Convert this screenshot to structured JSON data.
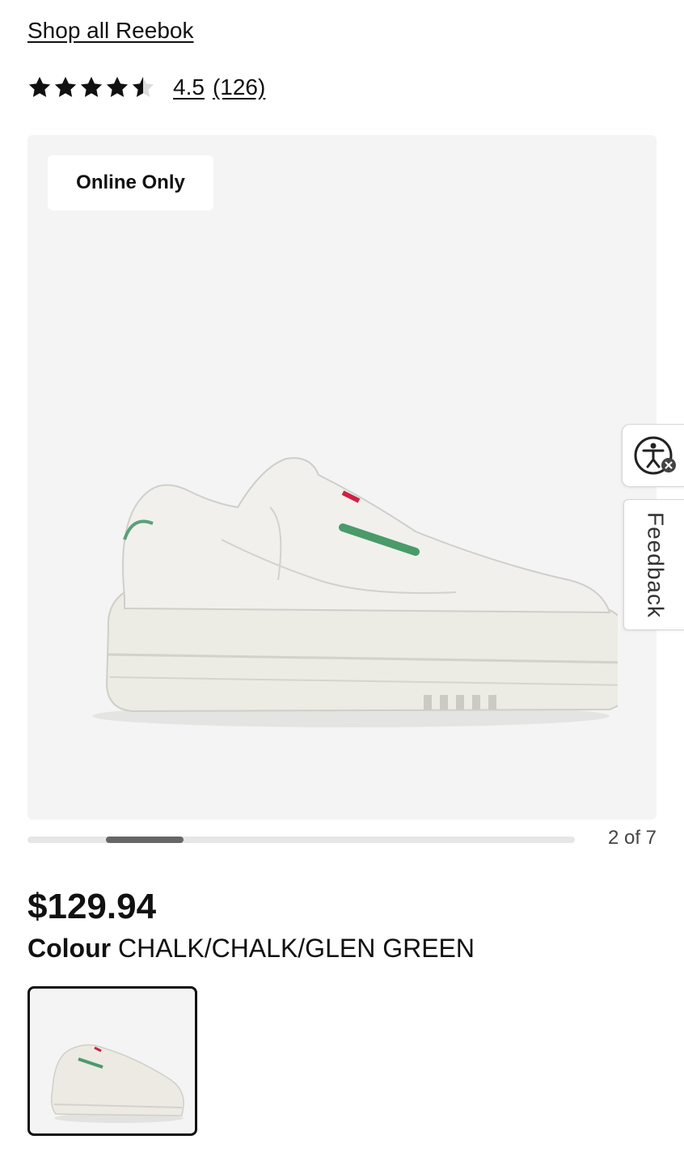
{
  "brand_link": "Shop all Reebok",
  "rating": {
    "value": 4.5,
    "value_text": "4.5",
    "count_text": "(126)"
  },
  "gallery": {
    "badge": "Online Only",
    "current_slide": 2,
    "total_slides": 7,
    "slide_counter": "2 of 7"
  },
  "product": {
    "price": "$129.94",
    "colour_label": "Colour",
    "colour_value": "CHALK/CHALK/GLEN GREEN"
  },
  "side_widgets": {
    "feedback_label": "Feedback"
  },
  "icons": {
    "star": "star-icon",
    "accessibility": "accessibility-icon"
  },
  "colors": {
    "text": "#111111",
    "gallery_bg": "#f4f4f4",
    "progress_track": "#e6e6e6",
    "progress_thumb": "#666666"
  }
}
